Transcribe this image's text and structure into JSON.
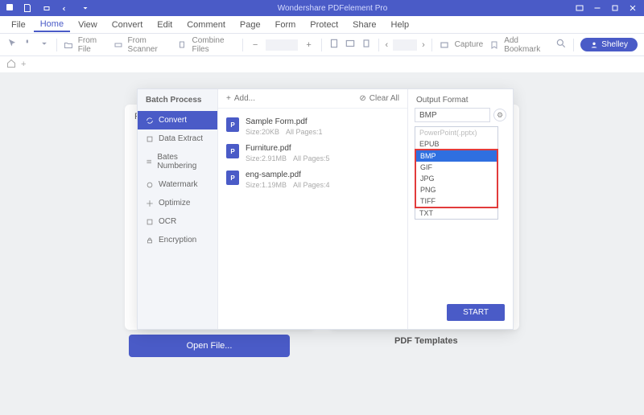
{
  "titlebar": {
    "title": "Wondershare PDFelement Pro"
  },
  "menus": [
    "File",
    "Home",
    "View",
    "Convert",
    "Edit",
    "Comment",
    "Page",
    "Form",
    "Protect",
    "Share",
    "Help"
  ],
  "active_menu": "Home",
  "toolbar": {
    "from_file": "From File",
    "from_scanner": "From Scanner",
    "combine": "Combine Files",
    "capture": "Capture",
    "bookmark": "Add Bookmark"
  },
  "user": "Shelley",
  "back": {
    "re": "Re",
    "open": "Open File...",
    "tpl": "PDF Templates"
  },
  "dialog": {
    "title": "Batch Process",
    "side": [
      "Convert",
      "Data Extract",
      "Bates Numbering",
      "Watermark",
      "Optimize",
      "OCR",
      "Encryption"
    ],
    "add": "Add...",
    "clear": "Clear All",
    "files": [
      {
        "name": "Sample Form.pdf",
        "size": "Size:20KB",
        "pages": "All Pages:1"
      },
      {
        "name": "Furniture.pdf",
        "size": "Size:2.91MB",
        "pages": "All Pages:5"
      },
      {
        "name": "eng-sample.pdf",
        "size": "Size:1.19MB",
        "pages": "All Pages:4"
      }
    ],
    "out_label": "Output Format",
    "selected": "BMP",
    "dd_top": [
      "PowerPoint(.pptx)",
      "EPUB"
    ],
    "dd_hl": [
      "BMP",
      "GIF",
      "JPG",
      "PNG",
      "TIFF"
    ],
    "dd_bot": [
      "TXT"
    ],
    "start": "START"
  }
}
